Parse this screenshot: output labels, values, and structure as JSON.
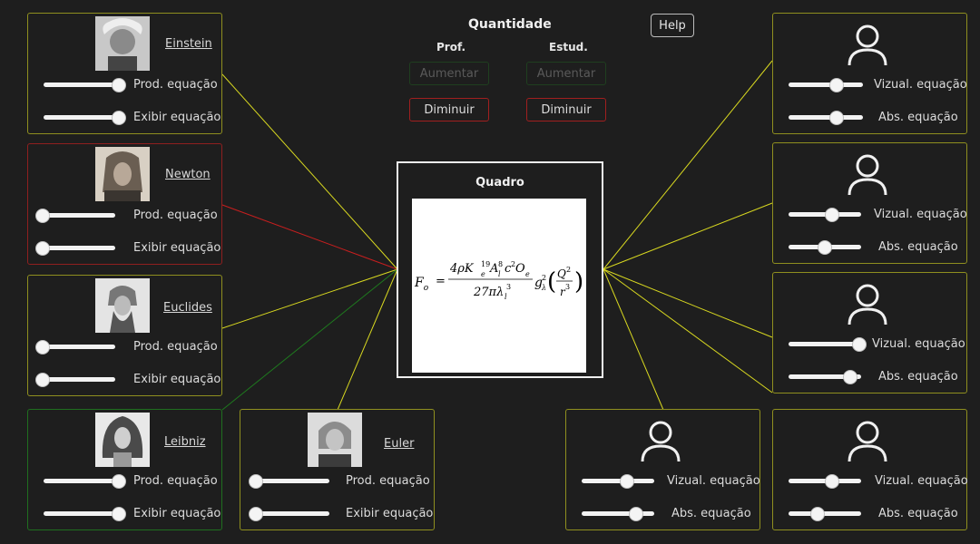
{
  "header": {
    "title": "Quantidade",
    "prof_label": "Prof.",
    "estud_label": "Estud."
  },
  "buttons": {
    "aumentar": "Aumentar",
    "diminuir": "Diminuir",
    "help": "Help"
  },
  "board": {
    "title": "Quadro"
  },
  "equation": {
    "lhs": "F",
    "lhs_sub": "o",
    "eq": "=",
    "num": "4ρK",
    "den": "27πλ",
    "tail": "g"
  },
  "professors": [
    {
      "name": "Einstein",
      "prod": "Prod. equação",
      "exibir": "Exibir equação",
      "prod_value": 0.97,
      "exibir_value": 0.97
    },
    {
      "name": "Newton",
      "prod": "Prod. equação",
      "exibir": "Exibir equação",
      "prod_value": 0.03,
      "exibir_value": 0.03
    },
    {
      "name": "Euclides",
      "prod": "Prod. equação",
      "exibir": "Exibir equação",
      "prod_value": 0.03,
      "exibir_value": 0.03
    },
    {
      "name": "Leibniz",
      "prod": "Prod. equação",
      "exibir": "Exibir equação",
      "prod_value": 0.97,
      "exibir_value": 0.97
    },
    {
      "name": "Euler",
      "prod": "Prod. equação",
      "exibir": "Exibir equação",
      "prod_value": 0.03,
      "exibir_value": 0.03
    }
  ],
  "students": [
    {
      "vizual": "Vizual. equação",
      "abs": "Abs. equação",
      "vizual_value": 0.65,
      "abs_value": 0.65
    },
    {
      "vizual": "Vizual. equação",
      "abs": "Abs. equação",
      "vizual_value": 0.6,
      "abs_value": 0.5
    },
    {
      "vizual": "Vizual. equação",
      "abs": "Abs. equação",
      "vizual_value": 0.97,
      "abs_value": 0.85
    },
    {
      "vizual": "Vizual. equação",
      "abs": "Abs. equação",
      "vizual_value": 0.62,
      "abs_value": 0.75
    },
    {
      "vizual": "Vizual. equação",
      "abs": "Abs. equação",
      "vizual_value": 0.6,
      "abs_value": 0.4
    }
  ],
  "colors": {
    "yellow": "#d8d820",
    "red": "#c81e1e",
    "green": "#1e7a1e",
    "background": "#1e1e1e"
  }
}
